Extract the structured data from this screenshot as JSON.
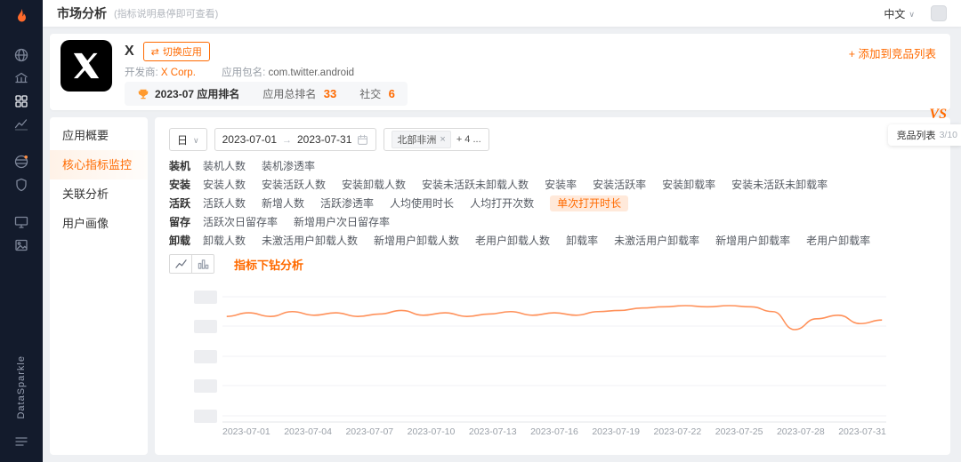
{
  "colors": {
    "accent": "#ff6a00",
    "line": "#ff915a",
    "sidebar_bg": "#131b2c"
  },
  "sidebar": {
    "brand": "DataSparkle",
    "icons": [
      {
        "name": "globe"
      },
      {
        "name": "bank"
      },
      {
        "name": "apps-grid",
        "active": true
      },
      {
        "name": "trend-chart"
      },
      {
        "name": "world"
      },
      {
        "name": "badge"
      },
      {
        "name": "monitor"
      },
      {
        "name": "gallery"
      }
    ],
    "bottom_icon": "menu"
  },
  "header": {
    "title": "市场分析",
    "hint": "(指标说明悬停即可查看)",
    "language": "中文"
  },
  "app_card": {
    "name": "X",
    "switch_label": "切换应用",
    "developer_label": "开发商:",
    "developer": "X Corp.",
    "package_label": "应用包名:",
    "package": "com.twitter.android",
    "rank_period": "2023-07 应用排名",
    "total_rank_label": "应用总排名",
    "total_rank": "33",
    "category_label": "社交",
    "category_rank": "6",
    "add_label": "+ 添加到竞品列表"
  },
  "vs_panel": {
    "vs": "VS",
    "list_label": "竞品列表",
    "count": "3/10"
  },
  "nav": {
    "items": [
      {
        "id": "app-overview",
        "label": "应用概要"
      },
      {
        "id": "core-metrics",
        "label": "核心指标监控",
        "active": true
      },
      {
        "id": "relation-analysis",
        "label": "关联分析"
      },
      {
        "id": "user-profile",
        "label": "用户画像"
      }
    ]
  },
  "filters": {
    "granularity": "日",
    "date_start": "2023-07-01",
    "date_end": "2023-07-31",
    "region_tag": "北部非洲",
    "more_tag": "+ 4 ..."
  },
  "metrics": {
    "rows": [
      {
        "category": "装机",
        "items": [
          "装机人数",
          "装机渗透率"
        ]
      },
      {
        "category": "安装",
        "items": [
          "安装人数",
          "安装活跃人数",
          "安装卸载人数",
          "安装未活跃未卸载人数",
          "安装率",
          "安装活跃率",
          "安装卸载率",
          "安装未活跃未卸载率"
        ]
      },
      {
        "category": "活跃",
        "items": [
          "活跃人数",
          "新增人数",
          "活跃渗透率",
          "人均使用时长",
          "人均打开次数",
          "单次打开时长"
        ],
        "selected": "单次打开时长"
      },
      {
        "category": "留存",
        "items": [
          "活跃次日留存率",
          "新增用户次日留存率"
        ]
      },
      {
        "category": "卸载",
        "items": [
          "卸载人数",
          "未激活用户卸载人数",
          "新增用户卸载人数",
          "老用户卸载人数",
          "卸载率",
          "未激活用户卸载率",
          "新增用户卸载率",
          "老用户卸载率"
        ]
      }
    ]
  },
  "chart_toolbar": {
    "drill_label": "指标下钻分析"
  },
  "chart_data": {
    "type": "line",
    "title": "",
    "x": [
      "2023-07-01",
      "2023-07-02",
      "2023-07-03",
      "2023-07-04",
      "2023-07-05",
      "2023-07-06",
      "2023-07-07",
      "2023-07-08",
      "2023-07-09",
      "2023-07-10",
      "2023-07-11",
      "2023-07-12",
      "2023-07-13",
      "2023-07-14",
      "2023-07-15",
      "2023-07-16",
      "2023-07-17",
      "2023-07-18",
      "2023-07-19",
      "2023-07-20",
      "2023-07-21",
      "2023-07-22",
      "2023-07-23",
      "2023-07-24",
      "2023-07-25",
      "2023-07-26",
      "2023-07-27",
      "2023-07-28",
      "2023-07-29",
      "2023-07-30",
      "2023-07-31"
    ],
    "series": [
      {
        "name": "单次打开时长",
        "values": [
          116,
          119,
          116,
          120,
          117,
          119,
          116,
          118,
          121,
          117,
          119,
          116,
          118,
          120,
          117,
          119,
          117,
          120,
          121,
          123,
          124,
          125,
          124,
          125,
          124,
          120,
          105,
          114,
          117,
          110,
          113
        ]
      }
    ],
    "x_tick_labels": [
      "2023-07-01",
      "2023-07-04",
      "2023-07-07",
      "2023-07-10",
      "2023-07-13",
      "2023-07-16",
      "2023-07-19",
      "2023-07-22",
      "2023-07-25",
      "2023-07-28",
      "2023-07-31"
    ],
    "y_axis": "loading-skeleton",
    "line_color": "#ff915a",
    "grid": true,
    "legend": false
  }
}
